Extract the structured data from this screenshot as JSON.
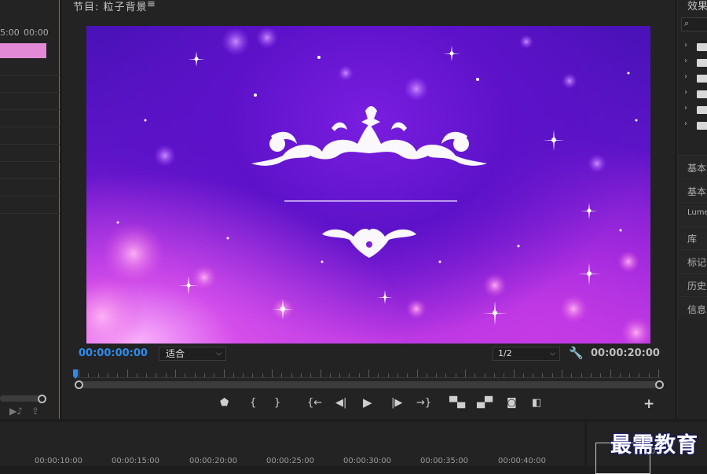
{
  "source_panel": {
    "ruler_labels": [
      "5:00",
      "00:00"
    ],
    "clip_color": "#e28ad6"
  },
  "program_monitor": {
    "title": "节目: 粒子背景",
    "menu_icon": "≡",
    "current_timecode": "00:00:00:00",
    "duration_timecode": "00:00:20:00",
    "zoom_select": "适合",
    "resolution_select": "1/2",
    "accent_color": "#2d8ceb",
    "playhead_position": 0,
    "video_content": "purple particle background with ornament",
    "controls": [
      {
        "name": "add-marker-button",
        "icon": "marker-icon",
        "glyph": "⬟"
      },
      {
        "name": "mark-in-button",
        "icon": "mark-in-icon",
        "glyph": "{"
      },
      {
        "name": "mark-out-button",
        "icon": "mark-out-icon",
        "glyph": "}"
      },
      {
        "name": "go-to-in-button",
        "icon": "go-to-in-icon",
        "glyph": "{←"
      },
      {
        "name": "step-back-button",
        "icon": "step-back-icon",
        "glyph": "◀|"
      },
      {
        "name": "play-button",
        "icon": "play-icon",
        "glyph": "▶"
      },
      {
        "name": "step-forward-button",
        "icon": "step-forward-icon",
        "glyph": "|▶"
      },
      {
        "name": "go-to-out-button",
        "icon": "go-to-out-icon",
        "glyph": "→}"
      },
      {
        "name": "lift-button",
        "icon": "lift-icon",
        "glyph": "▀▄"
      },
      {
        "name": "extract-button",
        "icon": "extract-icon",
        "glyph": "▄▀"
      },
      {
        "name": "export-frame-button",
        "icon": "camera-icon",
        "glyph": "◙"
      },
      {
        "name": "comparison-view-button",
        "icon": "comparison-icon",
        "glyph": "◧"
      }
    ],
    "add_button": "+"
  },
  "effects_panel": {
    "title": "效果",
    "search_icon": "⌕",
    "folder_rows": 6,
    "tabs": [
      "基本",
      "基本",
      "Lume",
      "库",
      "标记",
      "历史",
      "信息"
    ]
  },
  "timeline": {
    "labels": [
      "00:00:10:00",
      "00:00:15:00",
      "00:00:20:00",
      "00:00:25:00",
      "00:00:30:00",
      "00:00:35:00",
      "00:00:40:00"
    ],
    "right_digit": "0"
  },
  "watermark": "最需教育"
}
